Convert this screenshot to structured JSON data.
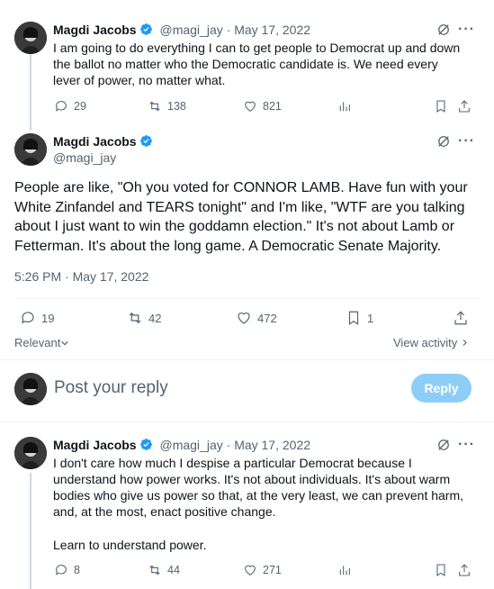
{
  "colors": {
    "accent": "#1d9bf0",
    "muted": "#536471",
    "reply_btn": "#8ecdf8"
  },
  "tweet1": {
    "name": "Magdi Jacobs",
    "handle": "@magi_jay",
    "date": "May 17, 2022",
    "text": "I am going to do everything I can to get people to Democrat up and down the ballot no matter who the Democratic candidate is. We need every lever of power, no matter what.",
    "replies": "29",
    "retweets": "138",
    "likes": "821"
  },
  "main_tweet": {
    "name": "Magdi Jacobs",
    "handle": "@magi_jay",
    "text": "People are like, \"Oh you voted for CONNOR LAMB. Have fun with your White Zinfandel and TEARS tonight\" and I'm like, \"WTF are you talking about I just want to win the goddamn election.\" It's not about Lamb or Fetterman. It's about the long game. A Democratic Senate Majority.",
    "timestamp": "5:26 PM · May 17, 2022",
    "replies": "19",
    "retweets": "42",
    "likes": "472",
    "bookmarks": "1",
    "relevant_label": "Relevant",
    "view_activity_label": "View activity"
  },
  "composer": {
    "placeholder": "Post your reply",
    "reply_label": "Reply"
  },
  "tweet3": {
    "name": "Magdi Jacobs",
    "handle": "@magi_jay",
    "date": "May 17, 2022",
    "text": "I don't care how much I despise a particular Democrat because I understand how power works. It's not about individuals. It's about warm bodies who give us power so that, at the very least, we can prevent harm, and, at the most, enact positive change.",
    "text2": "Learn to understand power.",
    "replies": "8",
    "retweets": "44",
    "likes": "271"
  },
  "icons": [
    "verified-badge-icon",
    "grok-icon",
    "more-icon",
    "reply-icon",
    "retweet-icon",
    "like-icon",
    "views-icon",
    "bookmark-icon",
    "share-icon",
    "chevron-down-icon",
    "chevron-right-icon"
  ]
}
